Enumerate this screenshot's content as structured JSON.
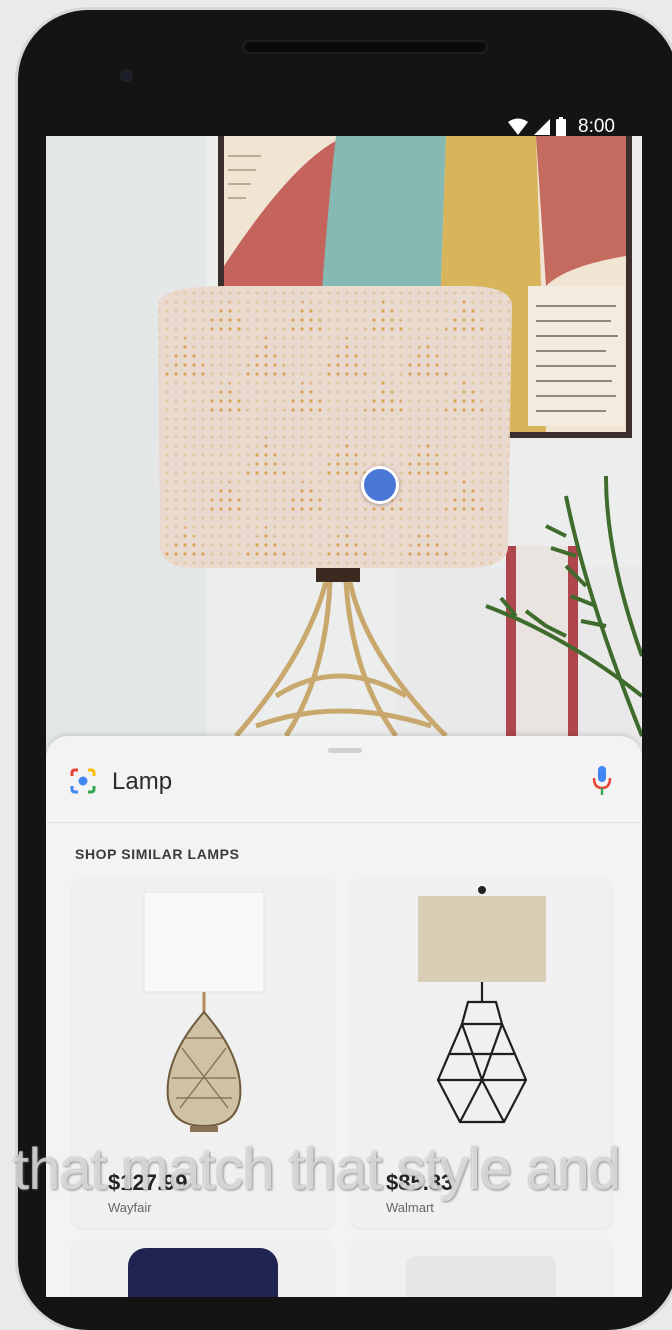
{
  "status_bar": {
    "time": "8:00"
  },
  "search": {
    "query": "Lamp"
  },
  "section": {
    "title": "SHOP SIMILAR LAMPS"
  },
  "products": [
    {
      "price": "$127.99",
      "seller": "Wayfair"
    },
    {
      "price": "$85.83",
      "seller": "Walmart"
    }
  ],
  "caption": {
    "text": "s that match that style and"
  },
  "icons": {
    "lens": "google-lens-icon",
    "mic": "mic-icon",
    "wifi": "wifi-icon",
    "signal": "signal-icon",
    "battery": "battery-icon"
  },
  "colors": {
    "focus_dot": "#4a78d8",
    "mic_blue": "#4285f4",
    "mic_red": "#ea4335",
    "sheet_bg": "#f2f3f2"
  }
}
